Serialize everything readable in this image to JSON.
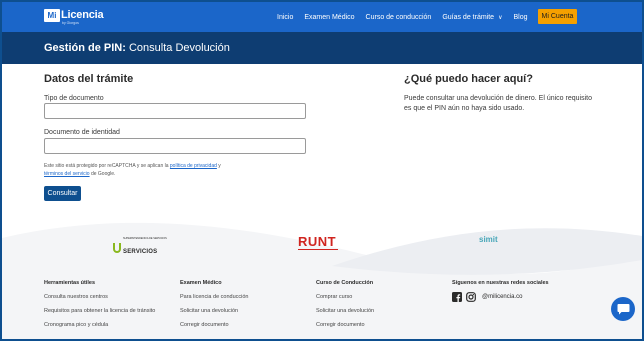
{
  "brand": {
    "logo_mark": "Mi",
    "logo_text": "Licencia",
    "logo_sub": "by Giorgos"
  },
  "nav": {
    "items": [
      {
        "label": "Inicio"
      },
      {
        "label": "Examen Médico"
      },
      {
        "label": "Curso de conducción"
      },
      {
        "label": "Guías de trámite"
      },
      {
        "label": "Blog"
      }
    ],
    "cta_label": "Mi Cuenta"
  },
  "banner": {
    "title_bold": "Gestión de PIN:",
    "title_rest": "Consulta Devolución"
  },
  "form": {
    "heading": "Datos del trámite",
    "doc_type_label": "Tipo de documento",
    "doc_type_value": "",
    "doc_id_label": "Documento de identidad",
    "doc_id_value": "",
    "recaptcha_text_1": "Este sitio está protegido por reCAPTCHA y se aplican la ",
    "privacy_link": "política de privacidad",
    "recaptcha_text_2": " y ",
    "terms_link": "términos del servicio",
    "recaptcha_text_3": " de Google.",
    "submit_label": "Consultar"
  },
  "info": {
    "heading": "¿Qué puedo hacer aquí?",
    "body": "Puede consultar una devolución de dinero. El único requisito es que el PIN aún no haya sido usado."
  },
  "partners": {
    "servicios_top": "SUPERINTENDENCIA DE SERVICIOS",
    "servicios": "SERVICIOS",
    "runt": "RUNT",
    "simit": "simit"
  },
  "footer": {
    "columns": [
      {
        "heading": "Herramientas útiles",
        "items": [
          "Consulta nuestros centros",
          "Requisitos para obtener la licencia de tránsito",
          "Cronograma pico y cédula"
        ]
      },
      {
        "heading": "Examen Médico",
        "items": [
          "Para licencia de conducción",
          "Solicitar una devolución",
          "Corregir documento"
        ]
      },
      {
        "heading": "Curso de Conducción",
        "items": [
          "Comprar curso",
          "Solicitar una devolución",
          "Corregir documento"
        ]
      }
    ],
    "social_heading": "Síguenos en nuestras redes sociales",
    "social_handle": "@milicencia.co"
  },
  "colors": {
    "primary": "#1b66c9",
    "banner": "#0e3d72",
    "cta": "#f5a000",
    "button": "#0e4f8f",
    "runt": "#d0241f",
    "servicios": "#8ab81f",
    "simit": "#47a6b8"
  },
  "icons": [
    "chevron-down-icon",
    "facebook-icon",
    "instagram-icon",
    "chat-icon"
  ]
}
